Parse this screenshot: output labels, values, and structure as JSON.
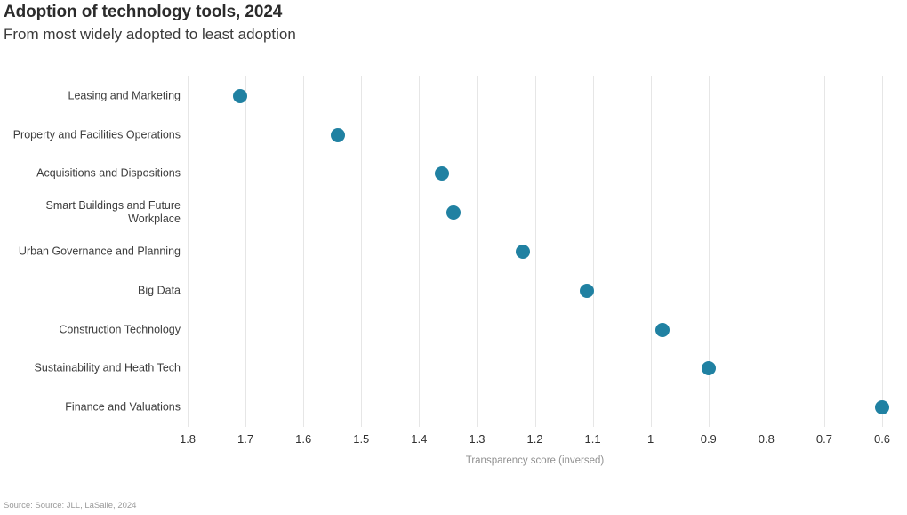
{
  "header": {
    "title": "Adoption of technology tools, 2024",
    "subtitle": "From most widely adopted to least adoption"
  },
  "footer": {
    "source": "Source: Source: JLL, LaSalle, 2024"
  },
  "chart_data": {
    "type": "scatter",
    "title": "Adoption of technology tools, 2024",
    "subtitle": "From most widely adopted to least adoption",
    "xlabel": "Transparency score (inversed)",
    "ylabel": "",
    "xlim": [
      1.8,
      0.6
    ],
    "x_axis_reversed": true,
    "xticks": [
      "1.8",
      "1.7",
      "1.6",
      "1.5",
      "1.4",
      "1.3",
      "1.2",
      "1.1",
      "1",
      "0.9",
      "0.8",
      "0.7",
      "0.6"
    ],
    "xtick_values": [
      1.8,
      1.7,
      1.6,
      1.5,
      1.4,
      1.3,
      1.2,
      1.1,
      1.0,
      0.9,
      0.8,
      0.7,
      0.6
    ],
    "grid": "vertical",
    "legend": "none",
    "marker_color": "#2081a2",
    "categories": [
      "Leasing and Marketing",
      "Property and Facilities Operations",
      "Acquisitions and Dispositions",
      "Smart Buildings and Future\nWorkplace",
      "Urban Governance and Planning",
      "Big Data",
      "Construction Technology",
      "Sustainability and Heath Tech",
      "Finance and Valuations"
    ],
    "values": [
      1.71,
      1.54,
      1.36,
      1.34,
      1.22,
      1.11,
      0.98,
      0.9,
      0.6
    ],
    "points": [
      {
        "category": "Leasing and Marketing",
        "value": 1.71
      },
      {
        "category": "Property and Facilities Operations",
        "value": 1.54
      },
      {
        "category": "Acquisitions and Dispositions",
        "value": 1.36
      },
      {
        "category": "Smart Buildings and Future\nWorkplace",
        "value": 1.34
      },
      {
        "category": "Urban Governance and Planning",
        "value": 1.22
      },
      {
        "category": "Big Data",
        "value": 1.11
      },
      {
        "category": "Construction Technology",
        "value": 0.98
      },
      {
        "category": "Sustainability and Heath Tech",
        "value": 0.9
      },
      {
        "category": "Finance and Valuations",
        "value": 0.6
      }
    ]
  }
}
